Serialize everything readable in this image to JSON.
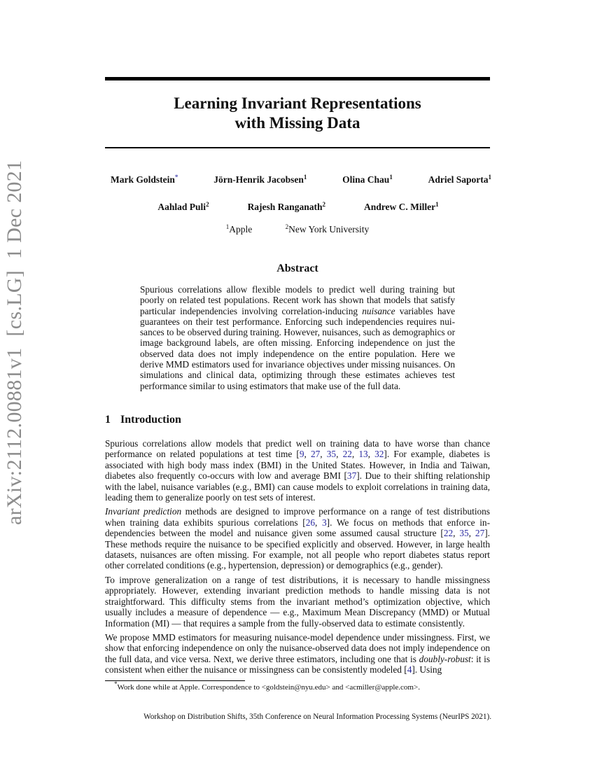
{
  "arxiv_stamp": {
    "id": "arXiv:2112.00881v1",
    "category": "[cs.LG]",
    "date": "1 Dec 2021"
  },
  "paper": {
    "title_line1": "Learning Invariant Representations",
    "title_line2": "with Missing Data",
    "authors_row1": [
      {
        "name": "Mark Goldstein",
        "mark": "*"
      },
      {
        "name": "Jörn-Henrik Jacobsen",
        "mark": "1"
      },
      {
        "name": "Olina Chau",
        "mark": "1"
      },
      {
        "name": "Adriel Saporta",
        "mark": "1"
      }
    ],
    "authors_row2": [
      {
        "name": "Aahlad Puli",
        "mark": "2"
      },
      {
        "name": "Rajesh Ranganath",
        "mark": "2"
      },
      {
        "name": "Andrew C. Miller",
        "mark": "1"
      }
    ],
    "affiliations": [
      {
        "mark": "1",
        "name": "Apple"
      },
      {
        "mark": "2",
        "name": "New York University"
      }
    ],
    "abstract_heading": "Abstract",
    "abstract": {
      "a1": "Spurious correlations allow flexible models to predict well during training but poorly on related test populations. Recent work has shown that models that satisfy particular independencies involving correlation-inducing ",
      "a_em": "nuisance",
      "a2": " variables have guarantees on their test performance. Enforcing such independencies requires nui­sances to be observed during training. However, nuisances, such as demographics or image background labels, are often missing. Enforcing independence on just the observed data does not imply independence on the entire population. Here we derive ",
      "a_sc": "MMD",
      "a3": " estimators used for invariance objectives under missing nuisances. On simulations and clinical data, optimizing through these estimates achieves test performance similar to using estimators that make use of the full data."
    },
    "section": {
      "number": "1",
      "title": "Introduction"
    },
    "paragraphs": {
      "p1": {
        "t1": "Spurious correlations allow models that predict well on training data to have worse than chance performance on related populations at test time [",
        "c1": [
          "9",
          "27",
          "35",
          "22",
          "13",
          "32"
        ],
        "t2": "]. For example, diabetes is associated with high body mass index (",
        "sc1": "BMI",
        "t3": ") in the United States. However, in India and Taiwan, diabetes also frequently co-occurs with low and average ",
        "sc2": "BMI",
        "t4": " [",
        "c2": "37",
        "t5": "]. Due to their shifting relationship with the label, nuisance variables (e.g., ",
        "sc3": "BMI",
        "t6": ") can cause models to exploit correlations in training data, leading them to generalize poorly on test sets of interest."
      },
      "p2": {
        "em": "Invariant prediction",
        "t1": " methods are designed to improve performance on a range of test distributions when training data exhibits spurious correlations [",
        "c1": [
          "26",
          "3"
        ],
        "t2": "]. We focus on methods that enforce in­dependencies between the model and nuisance given some assumed causal structure [",
        "c2": [
          "22",
          "35",
          "27"
        ],
        "t3": "]. These methods require the nuisance to be specified explicitly and observed. However, in large health datasets, nuisances are often missing. For example, not all people who report diabetes status report other correlated conditions (e.g., hypertension, depression) or demographics (e.g., gender)."
      },
      "p3": {
        "t1": "To improve generalization on a range of test distributions, it is necessary to handle missingness appropriately. However, extending invariant prediction methods to handle missing data is not straightforward. This difficulty stems from the invariant method’s optimization objective, which usually includes a measure of dependence — e.g., Maximum Mean Discrepancy (",
        "sc1": "MMD",
        "t2": ") or Mutual Information (",
        "sc2": "MI",
        "t3": ") — that requires a sample from the fully-observed data to estimate consistently."
      },
      "p4": {
        "t1": "We propose ",
        "sc1": "MMD",
        "t2": " estimators for measuring nuisance-model dependence under missingness. First, we show that enforcing independence on only the nuisance-observed data does not imply independence on the full data, and vice versa. Next, we derive three estimators, including one that is ",
        "em": "doubly-robust",
        "t3": ": it is consistent when either the nuisance or missingness can be consistently modeled [",
        "c1": "4",
        "t4": "]. Using"
      }
    },
    "footnote": {
      "mark": "*",
      "text": "Work done while at Apple. Correspondence to <goldstein@nyu.edu> and <acmiller@apple.com>."
    },
    "venue": "Workshop on Distribution Shifts, 35th Conference on Neural Information Processing Systems (NeurIPS 2021)."
  }
}
